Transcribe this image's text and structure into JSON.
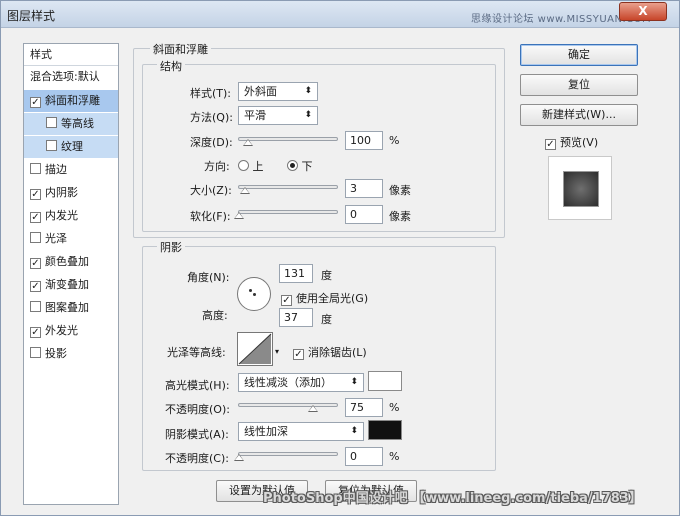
{
  "window": {
    "title": "图层样式",
    "watermark_top": "思缘设计论坛 www.MISSYUAN.COM",
    "close_label": "X"
  },
  "styles_list": {
    "header": "样式",
    "blend_options": "混合选项:默认",
    "items": [
      {
        "label": "斜面和浮雕",
        "checked": true
      },
      {
        "label": "等高线",
        "checked": false
      },
      {
        "label": "纹理",
        "checked": false
      },
      {
        "label": "描边",
        "checked": false
      },
      {
        "label": "内阴影",
        "checked": true
      },
      {
        "label": "内发光",
        "checked": true
      },
      {
        "label": "光泽",
        "checked": false
      },
      {
        "label": "颜色叠加",
        "checked": true
      },
      {
        "label": "渐变叠加",
        "checked": true
      },
      {
        "label": "图案叠加",
        "checked": false
      },
      {
        "label": "外发光",
        "checked": true
      },
      {
        "label": "投影",
        "checked": false
      }
    ]
  },
  "bevel": {
    "group_title": "斜面和浮雕",
    "structure_title": "结构",
    "style_label": "样式(T):",
    "style_value": "外斜面",
    "method_label": "方法(Q):",
    "method_value": "平滑",
    "depth_label": "深度(D):",
    "depth_value": "100",
    "depth_unit": "%",
    "depth_fraction": 0.1,
    "direction_label": "方向:",
    "dir_up": "上",
    "dir_down": "下",
    "size_label": "大小(Z):",
    "size_value": "3",
    "size_unit": "像素",
    "soften_label": "软化(F):",
    "soften_value": "0",
    "soften_unit": "像素"
  },
  "shading": {
    "group_title": "阴影",
    "angle_label": "角度(N):",
    "angle_value": "131",
    "angle_unit": "度",
    "global_light_label": "使用全局光(G)",
    "altitude_label": "高度:",
    "altitude_value": "37",
    "altitude_unit": "度",
    "gloss_contour_label": "光泽等高线:",
    "antialias_label": "消除锯齿(L)",
    "highlight_mode_label": "高光模式(H):",
    "highlight_mode_value": "线性减淡（添加）",
    "highlight_color": "#ffffff",
    "highlight_opacity_label": "不透明度(O):",
    "highlight_opacity_value": "75",
    "highlight_opacity_unit": "%",
    "shadow_mode_label": "阴影模式(A):",
    "shadow_mode_value": "线性加深",
    "shadow_color": "#111111",
    "shadow_opacity_label": "不透明度(C):",
    "shadow_opacity_value": "0",
    "shadow_opacity_unit": "%"
  },
  "footer": {
    "make_default": "设置为默认值",
    "reset_default": "复位为默认值",
    "watermark": "PhotoShop中国设计吧 【www.lineeg.com/tieba/1783】"
  },
  "actions": {
    "ok": "确定",
    "reset": "复位",
    "new_style": "新建样式(W)...",
    "preview_label": "预览(V)"
  }
}
